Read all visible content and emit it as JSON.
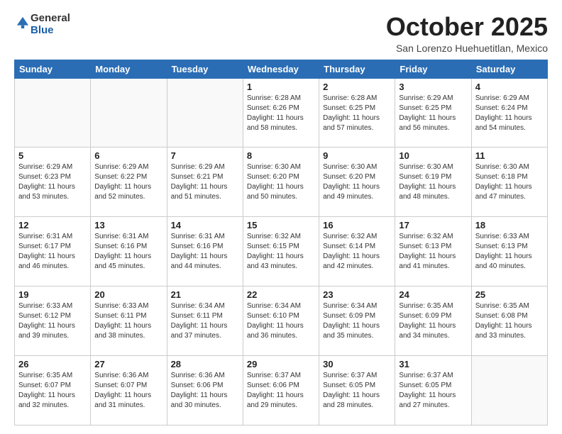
{
  "header": {
    "logo_general": "General",
    "logo_blue": "Blue",
    "month_title": "October 2025",
    "subtitle": "San Lorenzo Huehuetitlan, Mexico"
  },
  "weekdays": [
    "Sunday",
    "Monday",
    "Tuesday",
    "Wednesday",
    "Thursday",
    "Friday",
    "Saturday"
  ],
  "weeks": [
    [
      {
        "day": "",
        "sunrise": "",
        "sunset": "",
        "daylight": ""
      },
      {
        "day": "",
        "sunrise": "",
        "sunset": "",
        "daylight": ""
      },
      {
        "day": "",
        "sunrise": "",
        "sunset": "",
        "daylight": ""
      },
      {
        "day": "1",
        "sunrise": "Sunrise: 6:28 AM",
        "sunset": "Sunset: 6:26 PM",
        "daylight": "Daylight: 11 hours and 58 minutes."
      },
      {
        "day": "2",
        "sunrise": "Sunrise: 6:28 AM",
        "sunset": "Sunset: 6:25 PM",
        "daylight": "Daylight: 11 hours and 57 minutes."
      },
      {
        "day": "3",
        "sunrise": "Sunrise: 6:29 AM",
        "sunset": "Sunset: 6:25 PM",
        "daylight": "Daylight: 11 hours and 56 minutes."
      },
      {
        "day": "4",
        "sunrise": "Sunrise: 6:29 AM",
        "sunset": "Sunset: 6:24 PM",
        "daylight": "Daylight: 11 hours and 54 minutes."
      }
    ],
    [
      {
        "day": "5",
        "sunrise": "Sunrise: 6:29 AM",
        "sunset": "Sunset: 6:23 PM",
        "daylight": "Daylight: 11 hours and 53 minutes."
      },
      {
        "day": "6",
        "sunrise": "Sunrise: 6:29 AM",
        "sunset": "Sunset: 6:22 PM",
        "daylight": "Daylight: 11 hours and 52 minutes."
      },
      {
        "day": "7",
        "sunrise": "Sunrise: 6:29 AM",
        "sunset": "Sunset: 6:21 PM",
        "daylight": "Daylight: 11 hours and 51 minutes."
      },
      {
        "day": "8",
        "sunrise": "Sunrise: 6:30 AM",
        "sunset": "Sunset: 6:20 PM",
        "daylight": "Daylight: 11 hours and 50 minutes."
      },
      {
        "day": "9",
        "sunrise": "Sunrise: 6:30 AM",
        "sunset": "Sunset: 6:20 PM",
        "daylight": "Daylight: 11 hours and 49 minutes."
      },
      {
        "day": "10",
        "sunrise": "Sunrise: 6:30 AM",
        "sunset": "Sunset: 6:19 PM",
        "daylight": "Daylight: 11 hours and 48 minutes."
      },
      {
        "day": "11",
        "sunrise": "Sunrise: 6:30 AM",
        "sunset": "Sunset: 6:18 PM",
        "daylight": "Daylight: 11 hours and 47 minutes."
      }
    ],
    [
      {
        "day": "12",
        "sunrise": "Sunrise: 6:31 AM",
        "sunset": "Sunset: 6:17 PM",
        "daylight": "Daylight: 11 hours and 46 minutes."
      },
      {
        "day": "13",
        "sunrise": "Sunrise: 6:31 AM",
        "sunset": "Sunset: 6:16 PM",
        "daylight": "Daylight: 11 hours and 45 minutes."
      },
      {
        "day": "14",
        "sunrise": "Sunrise: 6:31 AM",
        "sunset": "Sunset: 6:16 PM",
        "daylight": "Daylight: 11 hours and 44 minutes."
      },
      {
        "day": "15",
        "sunrise": "Sunrise: 6:32 AM",
        "sunset": "Sunset: 6:15 PM",
        "daylight": "Daylight: 11 hours and 43 minutes."
      },
      {
        "day": "16",
        "sunrise": "Sunrise: 6:32 AM",
        "sunset": "Sunset: 6:14 PM",
        "daylight": "Daylight: 11 hours and 42 minutes."
      },
      {
        "day": "17",
        "sunrise": "Sunrise: 6:32 AM",
        "sunset": "Sunset: 6:13 PM",
        "daylight": "Daylight: 11 hours and 41 minutes."
      },
      {
        "day": "18",
        "sunrise": "Sunrise: 6:33 AM",
        "sunset": "Sunset: 6:13 PM",
        "daylight": "Daylight: 11 hours and 40 minutes."
      }
    ],
    [
      {
        "day": "19",
        "sunrise": "Sunrise: 6:33 AM",
        "sunset": "Sunset: 6:12 PM",
        "daylight": "Daylight: 11 hours and 39 minutes."
      },
      {
        "day": "20",
        "sunrise": "Sunrise: 6:33 AM",
        "sunset": "Sunset: 6:11 PM",
        "daylight": "Daylight: 11 hours and 38 minutes."
      },
      {
        "day": "21",
        "sunrise": "Sunrise: 6:34 AM",
        "sunset": "Sunset: 6:11 PM",
        "daylight": "Daylight: 11 hours and 37 minutes."
      },
      {
        "day": "22",
        "sunrise": "Sunrise: 6:34 AM",
        "sunset": "Sunset: 6:10 PM",
        "daylight": "Daylight: 11 hours and 36 minutes."
      },
      {
        "day": "23",
        "sunrise": "Sunrise: 6:34 AM",
        "sunset": "Sunset: 6:09 PM",
        "daylight": "Daylight: 11 hours and 35 minutes."
      },
      {
        "day": "24",
        "sunrise": "Sunrise: 6:35 AM",
        "sunset": "Sunset: 6:09 PM",
        "daylight": "Daylight: 11 hours and 34 minutes."
      },
      {
        "day": "25",
        "sunrise": "Sunrise: 6:35 AM",
        "sunset": "Sunset: 6:08 PM",
        "daylight": "Daylight: 11 hours and 33 minutes."
      }
    ],
    [
      {
        "day": "26",
        "sunrise": "Sunrise: 6:35 AM",
        "sunset": "Sunset: 6:07 PM",
        "daylight": "Daylight: 11 hours and 32 minutes."
      },
      {
        "day": "27",
        "sunrise": "Sunrise: 6:36 AM",
        "sunset": "Sunset: 6:07 PM",
        "daylight": "Daylight: 11 hours and 31 minutes."
      },
      {
        "day": "28",
        "sunrise": "Sunrise: 6:36 AM",
        "sunset": "Sunset: 6:06 PM",
        "daylight": "Daylight: 11 hours and 30 minutes."
      },
      {
        "day": "29",
        "sunrise": "Sunrise: 6:37 AM",
        "sunset": "Sunset: 6:06 PM",
        "daylight": "Daylight: 11 hours and 29 minutes."
      },
      {
        "day": "30",
        "sunrise": "Sunrise: 6:37 AM",
        "sunset": "Sunset: 6:05 PM",
        "daylight": "Daylight: 11 hours and 28 minutes."
      },
      {
        "day": "31",
        "sunrise": "Sunrise: 6:37 AM",
        "sunset": "Sunset: 6:05 PM",
        "daylight": "Daylight: 11 hours and 27 minutes."
      },
      {
        "day": "",
        "sunrise": "",
        "sunset": "",
        "daylight": ""
      }
    ]
  ]
}
